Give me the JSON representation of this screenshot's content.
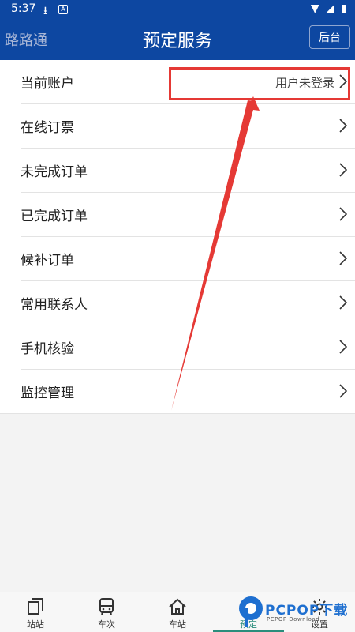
{
  "status_bar": {
    "time": "5:37"
  },
  "app_bar": {
    "app_name": "路路通",
    "title": "预定服务",
    "backend_button": "后台"
  },
  "menu": {
    "items": [
      {
        "label": "当前账户",
        "value": "用户未登录"
      },
      {
        "label": "在线订票"
      },
      {
        "label": "未完成订单"
      },
      {
        "label": "已完成订单"
      },
      {
        "label": "候补订单"
      },
      {
        "label": "常用联系人"
      },
      {
        "label": "手机核验"
      },
      {
        "label": "监控管理"
      }
    ]
  },
  "tab_bar": {
    "items": [
      {
        "label": "站站",
        "icon": "copy-icon"
      },
      {
        "label": "车次",
        "icon": "bus-icon"
      },
      {
        "label": "车站",
        "icon": "home-icon"
      },
      {
        "label": "预定",
        "icon": "ticket-icon",
        "active": true
      },
      {
        "label": "设置",
        "icon": "gear-icon"
      }
    ]
  },
  "watermark": {
    "brand": "PCPOP下载",
    "sub": "PCPOP Download"
  },
  "colors": {
    "header_blue": "#0d47a1",
    "annotation_red": "#e53935",
    "active_tab": "#2a8d7c"
  }
}
